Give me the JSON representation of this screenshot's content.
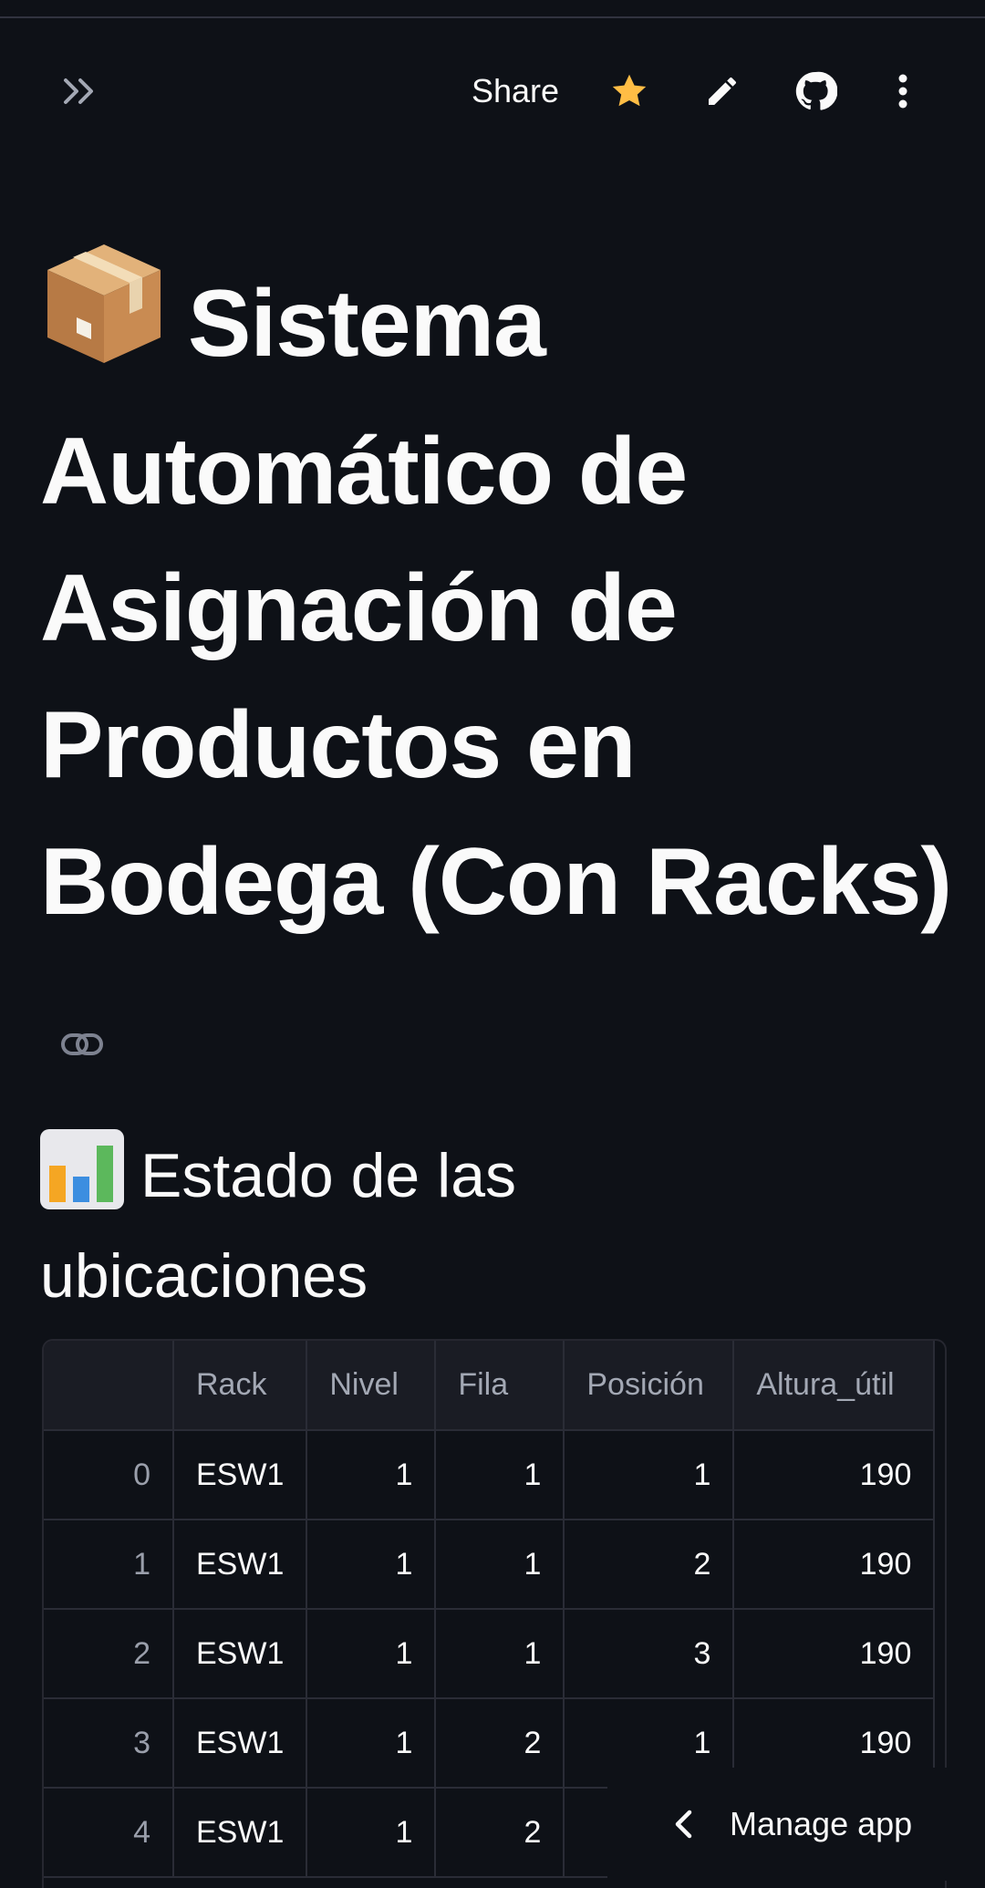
{
  "toolbar": {
    "share_label": "Share",
    "accent_color": "#ffbd45",
    "icons": [
      "expand-sidebar-icon",
      "star-icon",
      "pencil-icon",
      "github-icon",
      "more-vertical-icon"
    ]
  },
  "title": {
    "emoji": "package-box-icon",
    "text": "Sistema Automático de Asignación de Productos en Bodega (Con Racks)"
  },
  "subtitle": {
    "emoji": "bar-chart-icon",
    "text": "Estado de las ubicaciones"
  },
  "table": {
    "columns": [
      "",
      "Rack",
      "Nivel",
      "Fila",
      "Posición",
      "Altura_útil"
    ],
    "rows": [
      [
        "0",
        "ESW1",
        "1",
        "1",
        "1",
        "190"
      ],
      [
        "1",
        "ESW1",
        "1",
        "1",
        "2",
        "190"
      ],
      [
        "2",
        "ESW1",
        "1",
        "1",
        "3",
        "190"
      ],
      [
        "3",
        "ESW1",
        "1",
        "2",
        "1",
        "190"
      ],
      [
        "4",
        "ESW1",
        "1",
        "2",
        "",
        ""
      ]
    ]
  },
  "manage_app": {
    "label": "Manage app"
  }
}
